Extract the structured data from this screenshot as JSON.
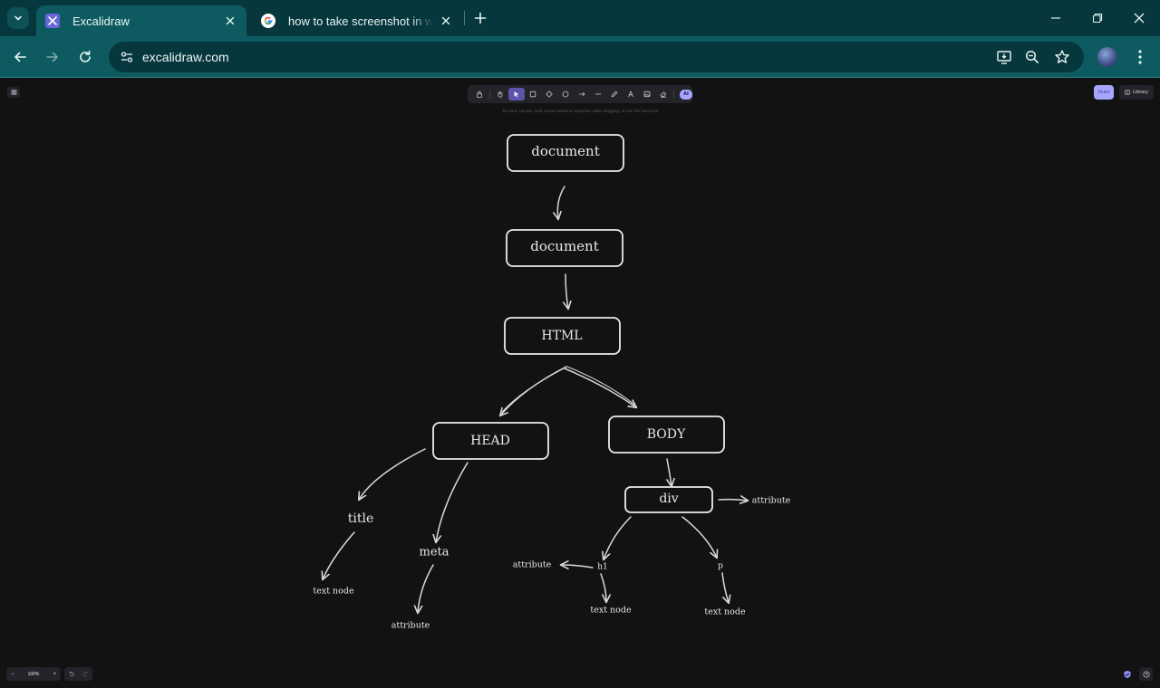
{
  "browser": {
    "tabs": [
      {
        "title": "Excalidraw",
        "active": true,
        "favicon": "excalidraw-logo-icon"
      },
      {
        "title": "how to take screenshot in windows",
        "active": false,
        "favicon": "google-g-icon"
      }
    ],
    "address": "excalidraw.com"
  },
  "excalidraw": {
    "hint": "To move canvas, hold mouse wheel or spacebar while dragging, or use the hand tool",
    "ai_label": "AI",
    "share_label": "Share",
    "library_label": "Library",
    "zoom_label": "100%",
    "zoom_out": "−",
    "zoom_in": "+",
    "accent_color": "#a8a5ff"
  },
  "diagram": {
    "nodes": [
      {
        "id": "document1",
        "label": "document",
        "boxed": true
      },
      {
        "id": "document2",
        "label": "document",
        "boxed": true
      },
      {
        "id": "html",
        "label": "HTML",
        "boxed": true
      },
      {
        "id": "head",
        "label": "HEAD",
        "boxed": true
      },
      {
        "id": "body",
        "label": "BODY",
        "boxed": true
      },
      {
        "id": "div",
        "label": "div",
        "boxed": true
      },
      {
        "id": "title",
        "label": "title",
        "boxed": false
      },
      {
        "id": "meta",
        "label": "meta",
        "boxed": false
      },
      {
        "id": "title_text",
        "label": "text node",
        "boxed": false
      },
      {
        "id": "meta_attr",
        "label": "attribute",
        "boxed": false
      },
      {
        "id": "div_attr",
        "label": "attribute",
        "boxed": false
      },
      {
        "id": "h1",
        "label": "h1",
        "boxed": false
      },
      {
        "id": "p",
        "label": "p",
        "boxed": false
      },
      {
        "id": "h1_attr",
        "label": "attribute",
        "boxed": false
      },
      {
        "id": "h1_text",
        "label": "text node",
        "boxed": false
      },
      {
        "id": "p_text",
        "label": "text node",
        "boxed": false
      }
    ],
    "edges": [
      {
        "from": "document1",
        "to": "document2"
      },
      {
        "from": "document2",
        "to": "html"
      },
      {
        "from": "html",
        "to": "head"
      },
      {
        "from": "html",
        "to": "body"
      },
      {
        "from": "head",
        "to": "title"
      },
      {
        "from": "head",
        "to": "meta"
      },
      {
        "from": "title",
        "to": "title_text"
      },
      {
        "from": "meta",
        "to": "meta_attr"
      },
      {
        "from": "body",
        "to": "div"
      },
      {
        "from": "div",
        "to": "div_attr"
      },
      {
        "from": "div",
        "to": "h1"
      },
      {
        "from": "div",
        "to": "p"
      },
      {
        "from": "h1",
        "to": "h1_attr"
      },
      {
        "from": "h1",
        "to": "h1_text"
      },
      {
        "from": "p",
        "to": "p_text"
      }
    ]
  }
}
